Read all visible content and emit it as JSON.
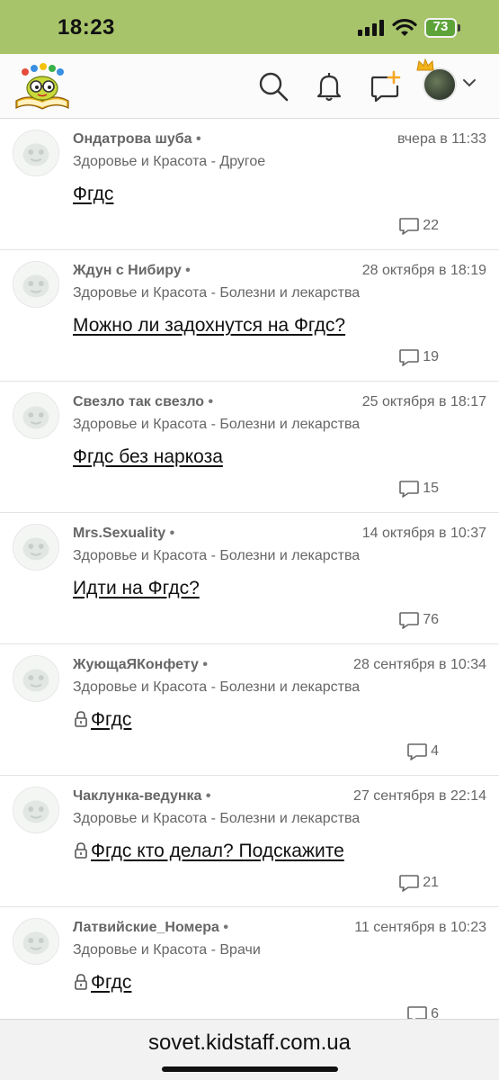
{
  "status_bar": {
    "time": "18:23",
    "battery": "73",
    "icons": [
      "signal-icon",
      "wifi-icon",
      "battery-icon"
    ]
  },
  "header": {
    "icons": [
      "site-logo",
      "search-icon",
      "bell-icon",
      "new-topic-icon",
      "avatar",
      "chevron-down-icon"
    ]
  },
  "posts": [
    {
      "author": "Ондатрова шуба",
      "date": "вчера в 11:33",
      "category": "Здоровье и Красота - Другое",
      "title": "Фгдс",
      "locked": false,
      "comments": "22"
    },
    {
      "author": "Ждун с Нибиру",
      "date": "28 октября в 18:19",
      "category": "Здоровье и Красота - Болезни и лекарства",
      "title": "Можно ли задохнутся на Фгдс?",
      "locked": false,
      "comments": "19"
    },
    {
      "author": "Свезло так свезло",
      "date": "25 октября в 18:17",
      "category": "Здоровье и Красота - Болезни и лекарства",
      "title": "Фгдс без наркоза",
      "locked": false,
      "comments": "15"
    },
    {
      "author": "Mrs.Sexuality",
      "date": "14 октября в 10:37",
      "category": "Здоровье и Красота - Болезни и лекарства",
      "title": "Идти на Фгдс?",
      "locked": false,
      "comments": "76"
    },
    {
      "author": "ЖующаЯКонфету",
      "date": "28 сентября в 10:34",
      "category": "Здоровье и Красота - Болезни и лекарства",
      "title": "Фгдс",
      "locked": true,
      "comments": "4"
    },
    {
      "author": "Чаклунка-ведунка",
      "date": "27 сентября в 22:14",
      "category": "Здоровье и Красота - Болезни и лекарства",
      "title": "Фгдс кто делал? Подскажите",
      "locked": true,
      "comments": "21"
    },
    {
      "author": "Латвийские_Номера",
      "date": "11 сентября в 10:23",
      "category": "Здоровье и Красота - Врачи",
      "title": "Фгдс",
      "locked": true,
      "comments": "6"
    }
  ],
  "url_bar": {
    "url": "sovet.kidstaff.com.ua"
  },
  "colors": {
    "status_bar_bg": "#a8c46a",
    "battery": "#5ea33a",
    "notification_accent": "#f5a623"
  }
}
